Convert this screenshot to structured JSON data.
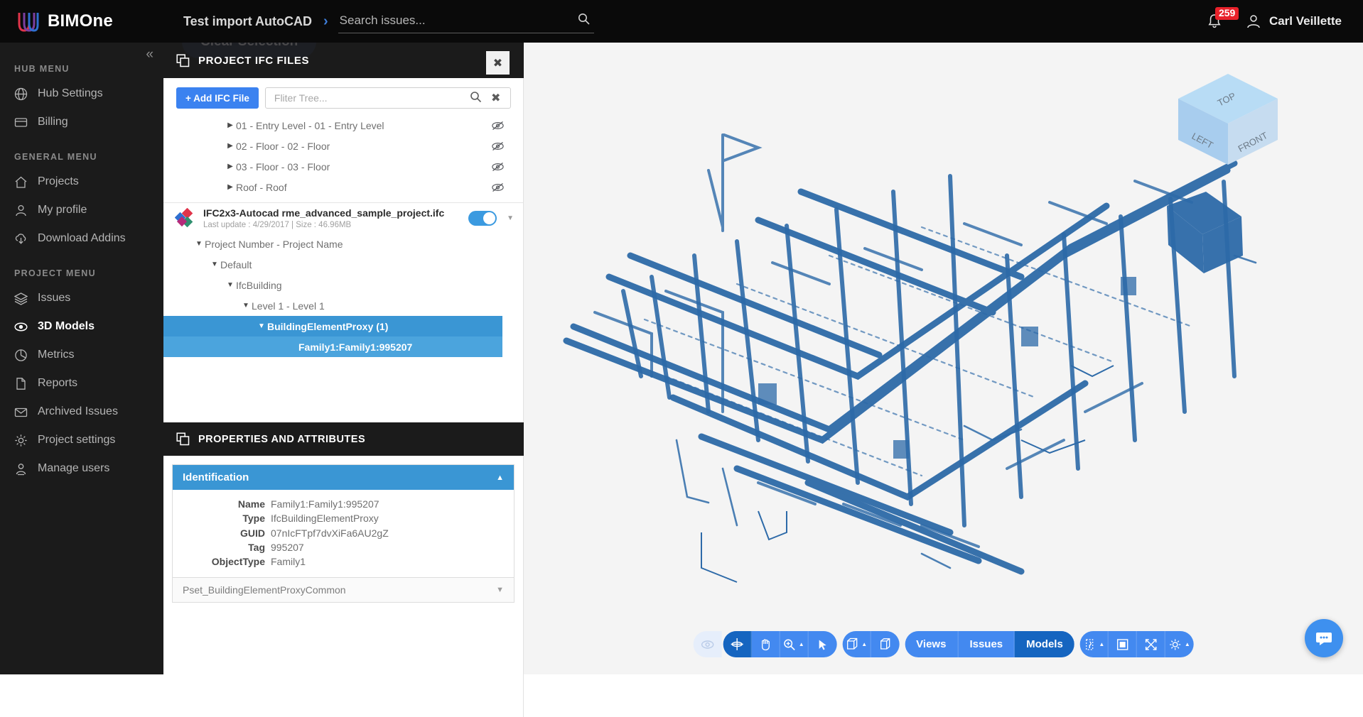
{
  "topbar": {
    "brand": "BIMOne",
    "breadcrumb": "Test import AutoCAD",
    "breadcrumb_sep": "›",
    "search_placeholder": "Search issues...",
    "notification_count": "259",
    "user_name": "Carl Veillette",
    "accent": "#3b82f0"
  },
  "sidebar": {
    "collapse_glyph": "«",
    "sections": [
      {
        "label": "HUB MENU",
        "items": [
          {
            "label": "Hub Settings",
            "icon": "globe-icon",
            "active": false
          },
          {
            "label": "Billing",
            "icon": "credit-card-icon",
            "active": false
          }
        ]
      },
      {
        "label": "GENERAL MENU",
        "items": [
          {
            "label": "Projects",
            "icon": "home-icon",
            "active": false
          },
          {
            "label": "My profile",
            "icon": "user-icon",
            "active": false
          },
          {
            "label": "Download Addins",
            "icon": "cloud-download-icon",
            "active": false
          }
        ]
      },
      {
        "label": "PROJECT MENU",
        "items": [
          {
            "label": "Issues",
            "icon": "layers-icon",
            "active": false
          },
          {
            "label": "3D Models",
            "icon": "eye-icon",
            "active": true
          },
          {
            "label": "Metrics",
            "icon": "pie-chart-icon",
            "active": false
          },
          {
            "label": "Reports",
            "icon": "document-icon",
            "active": false
          },
          {
            "label": "Archived Issues",
            "icon": "archive-icon",
            "active": false
          },
          {
            "label": "Project settings",
            "icon": "gear-icon",
            "active": false
          },
          {
            "label": "Manage users",
            "icon": "users-icon",
            "active": false
          }
        ]
      }
    ]
  },
  "ifc_panel": {
    "title": "PROJECT IFC FILES",
    "clear_selection_label": "Clear Selection",
    "close_label": "✖",
    "add_button": "+ Add IFC File",
    "filter_placeholder": "Fliter Tree...",
    "tree_top": [
      {
        "label": "01 - Entry Level - 01 - Entry Level",
        "indent": 3,
        "arrow": "▶",
        "eye": true
      },
      {
        "label": "02 - Floor - 02 - Floor",
        "indent": 3,
        "arrow": "▶",
        "eye": true
      },
      {
        "label": "03 - Floor - 03 - Floor",
        "indent": 3,
        "arrow": "▶",
        "eye": true
      },
      {
        "label": "Roof - Roof",
        "indent": 3,
        "arrow": "▶",
        "eye": true
      }
    ],
    "file": {
      "name": "IFC2x3-Autocad rme_advanced_sample_project.ifc",
      "meta": "Last update : 4/29/2017   |   Size : 46.96MB",
      "toggle_on": true
    },
    "tree_bottom": [
      {
        "label": "Project Number - Project Name",
        "indent": 1,
        "arrow": "▼",
        "state": "normal"
      },
      {
        "label": "Default",
        "indent": 2,
        "arrow": "▼",
        "state": "normal"
      },
      {
        "label": "IfcBuilding",
        "indent": 3,
        "arrow": "▼",
        "state": "normal"
      },
      {
        "label": "Level 1 - Level 1",
        "indent": 4,
        "arrow": "▼",
        "state": "normal"
      },
      {
        "label": "BuildingElementProxy (1)",
        "indent": 5,
        "arrow": "▼",
        "state": "selected"
      },
      {
        "label": "Family1:Family1:995207",
        "indent": 7,
        "arrow": "",
        "state": "selected-child"
      }
    ]
  },
  "properties": {
    "title": "PROPERTIES AND ATTRIBUTES",
    "group_open": {
      "title": "Identification",
      "toggle_glyph": "▲",
      "rows": [
        {
          "key": "Name",
          "value": "Family1:Family1:995207"
        },
        {
          "key": "Type",
          "value": "IfcBuildingElementProxy"
        },
        {
          "key": "GUID",
          "value": "07nIcFTpf7dvXiFa6AU2gZ"
        },
        {
          "key": "Tag",
          "value": "995207"
        },
        {
          "key": "ObjectType",
          "value": "Family1"
        }
      ]
    },
    "group_collapsed": {
      "title": "Pset_BuildingElementProxyCommon",
      "toggle_glyph": "▼"
    }
  },
  "viewer": {
    "viewcube": {
      "top": "TOP",
      "left": "LEFT",
      "front": "FRONT"
    },
    "toolbar": {
      "ghost_icon": "eye-disabled-icon",
      "group1": [
        {
          "icon": "orbit-icon",
          "label": "",
          "active": true,
          "caret": false
        },
        {
          "icon": "pan-hand-icon",
          "label": "",
          "active": false,
          "caret": false
        },
        {
          "icon": "zoom-icon",
          "label": "",
          "active": false,
          "caret": true
        },
        {
          "icon": "cursor-select-icon",
          "label": "",
          "active": false,
          "caret": false
        }
      ],
      "group2": [
        {
          "icon": "section-box-icon",
          "label": "",
          "active": false,
          "caret": true
        },
        {
          "icon": "box-solid-icon",
          "label": "",
          "active": false,
          "caret": false
        }
      ],
      "group3": [
        {
          "icon": "",
          "label": "Views",
          "active": false,
          "caret": false
        },
        {
          "icon": "",
          "label": "Issues",
          "active": false,
          "caret": false
        },
        {
          "icon": "",
          "label": "Models",
          "active": true,
          "caret": false
        }
      ],
      "group4": [
        {
          "icon": "measure-icon",
          "label": "",
          "active": false,
          "caret": true
        },
        {
          "icon": "crop-icon",
          "label": "",
          "active": false,
          "caret": false
        },
        {
          "icon": "fullscreen-icon",
          "label": "",
          "active": false,
          "caret": false
        },
        {
          "icon": "gear-icon",
          "label": "",
          "active": false,
          "caret": true
        }
      ]
    },
    "chat_icon": "chat-bubble-icon",
    "model_color": "#2d6aa8"
  }
}
